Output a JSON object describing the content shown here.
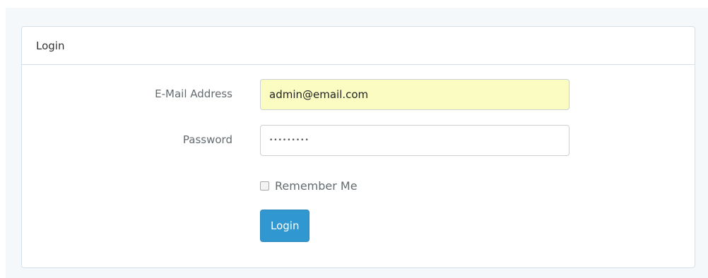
{
  "panel": {
    "heading": "Login"
  },
  "form": {
    "email": {
      "label": "E-Mail Address",
      "value": "admin@email.com"
    },
    "password": {
      "label": "Password",
      "value": "123456789"
    },
    "remember": {
      "label": "Remember Me",
      "checked": false
    },
    "submit": {
      "label": "Login"
    }
  },
  "colors": {
    "primary": "#3097d1",
    "autofill_bg": "#fafcc2",
    "border": "#d3e0e9",
    "page_bg": "#f5f8fa"
  }
}
